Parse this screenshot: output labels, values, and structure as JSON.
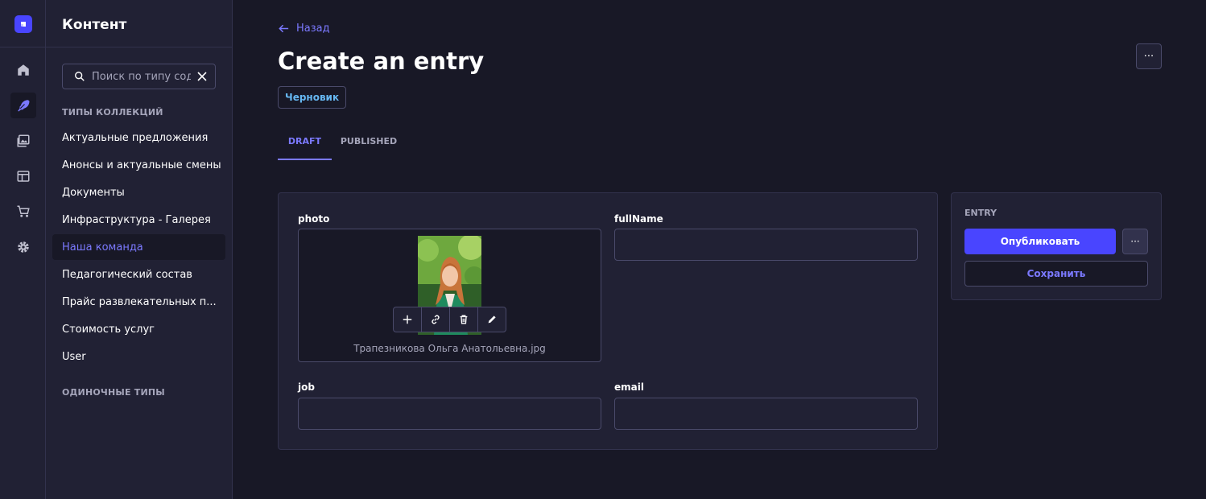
{
  "rail": {
    "items": [
      {
        "icon": "home-icon"
      },
      {
        "icon": "feather-icon",
        "active": true
      },
      {
        "icon": "media-library-icon"
      },
      {
        "icon": "layout-icon"
      },
      {
        "icon": "cart-icon"
      },
      {
        "icon": "gear-icon"
      }
    ]
  },
  "sidebar": {
    "title": "Контент",
    "search_placeholder": "Поиск по типу содержимого",
    "collection_types_label": "ТИПЫ КОЛЛЕКЦИЙ",
    "collection_types": [
      {
        "label": "Актуальные предложения"
      },
      {
        "label": "Анонсы и актуальные смены"
      },
      {
        "label": "Документы"
      },
      {
        "label": "Инфраструктура - Галерея"
      },
      {
        "label": "Наша команда",
        "active": true
      },
      {
        "label": "Педагогический состав"
      },
      {
        "label": "Прайс развлекательных п..."
      },
      {
        "label": "Стоимость услуг"
      },
      {
        "label": "User"
      }
    ],
    "single_types_label": "ОДИНОЧНЫЕ ТИПЫ"
  },
  "header": {
    "back_label": "Назад",
    "title": "Create an entry",
    "more_label": "···",
    "status_badge": "Черновик",
    "tabs": [
      {
        "label": "DRAFT",
        "active": true
      },
      {
        "label": "PUBLISHED"
      }
    ]
  },
  "form": {
    "photo_label": "photo",
    "photo_filename": "Трапезникова Ольга Анатольевна.jpg",
    "fullname_label": "fullName",
    "fullname_value": "",
    "job_label": "job",
    "job_value": "",
    "email_label": "email",
    "email_value": ""
  },
  "entry_panel": {
    "label": "ENTRY",
    "publish_label": "Опубликовать",
    "more_label": "···",
    "save_label": "Сохранить"
  },
  "colors": {
    "accent": "#4945ff",
    "accent_text": "#7b79ff",
    "background": "#181826",
    "surface": "#212134",
    "badge_text": "#66b7f1"
  }
}
